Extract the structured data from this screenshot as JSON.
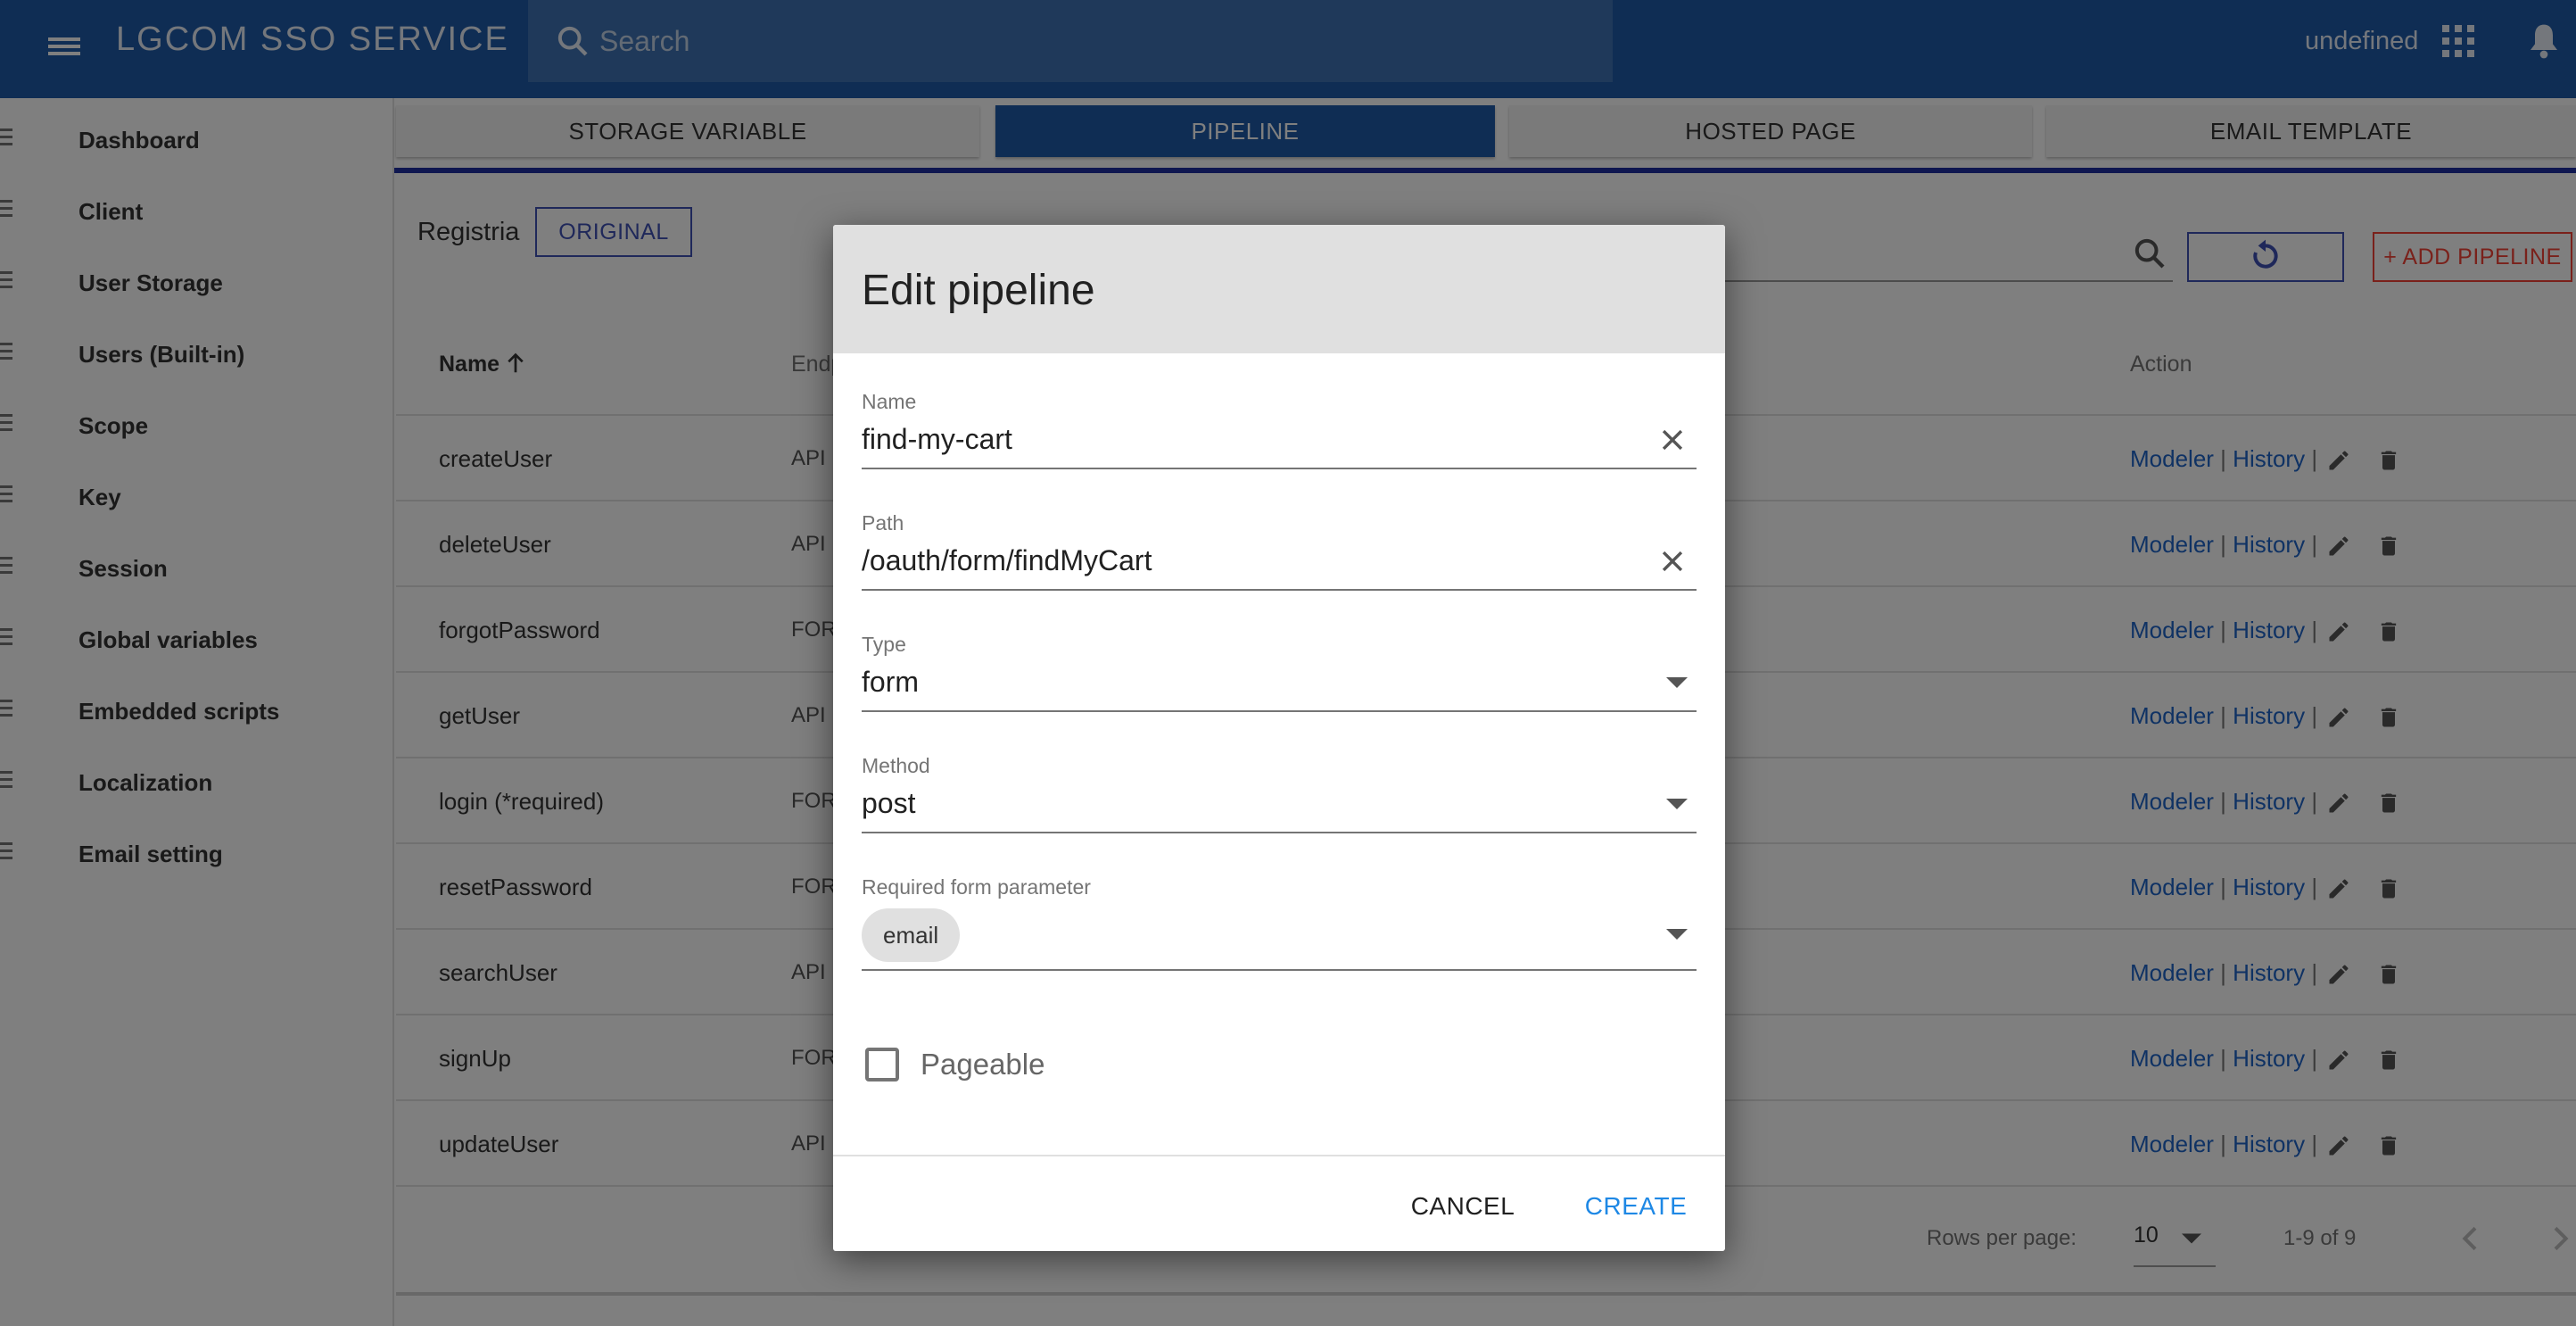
{
  "appbar": {
    "title": "LGCOM SSO SERVICE",
    "search_placeholder": "Search",
    "user": "undefined",
    "icons": [
      "menu-icon",
      "search-icon",
      "apps-grid-icon",
      "bell-icon"
    ],
    "color": "#1e5ba8"
  },
  "sidebar": {
    "items": [
      {
        "label": "Dashboard"
      },
      {
        "label": "Client"
      },
      {
        "label": "User Storage"
      },
      {
        "label": "Users (Built-in)"
      },
      {
        "label": "Scope"
      },
      {
        "label": "Key"
      },
      {
        "label": "Session"
      },
      {
        "label": "Global variables"
      },
      {
        "label": "Embedded scripts"
      },
      {
        "label": "Localization"
      },
      {
        "label": "Email setting"
      }
    ]
  },
  "tabs": [
    {
      "label": "STORAGE VARIABLE",
      "active": false
    },
    {
      "label": "PIPELINE",
      "active": true
    },
    {
      "label": "HOSTED PAGE",
      "active": false
    },
    {
      "label": "EMAIL TEMPLATE",
      "active": false
    }
  ],
  "toolbar": {
    "group": "Registria",
    "original_label": "ORIGINAL",
    "add_label": "+ ADD PIPELINE"
  },
  "table": {
    "headers": {
      "name": "Name",
      "endpoint": "Endp",
      "action": "Action"
    },
    "rows": [
      {
        "name": "createUser",
        "endpoint": "API |"
      },
      {
        "name": "deleteUser",
        "endpoint": "API |"
      },
      {
        "name": "forgotPassword",
        "endpoint": "FOR"
      },
      {
        "name": "getUser",
        "endpoint": "API |"
      },
      {
        "name": "login (*required)",
        "endpoint": "FOR"
      },
      {
        "name": "resetPassword",
        "endpoint": "FOR"
      },
      {
        "name": "searchUser",
        "endpoint": "API |"
      },
      {
        "name": "signUp",
        "endpoint": "FOR"
      },
      {
        "name": "updateUser",
        "endpoint": "API |"
      }
    ],
    "action_links": {
      "modeler": "Modeler",
      "history": "History",
      "separator": "|"
    }
  },
  "pagination": {
    "rows_per_page_label": "Rows per page:",
    "rows_per_page": "10",
    "range": "1-9 of 9"
  },
  "dialog": {
    "title": "Edit pipeline",
    "name_label": "Name",
    "name_value": "find-my-cart",
    "path_label": "Path",
    "path_value": "/oauth/form/findMyCart",
    "type_label": "Type",
    "type_value": "form",
    "method_label": "Method",
    "method_value": "post",
    "required_label": "Required form parameter",
    "required_chips": [
      "email"
    ],
    "pageable_label": "Pageable",
    "pageable_checked": false,
    "cancel_label": "CANCEL",
    "create_label": "CREATE"
  }
}
